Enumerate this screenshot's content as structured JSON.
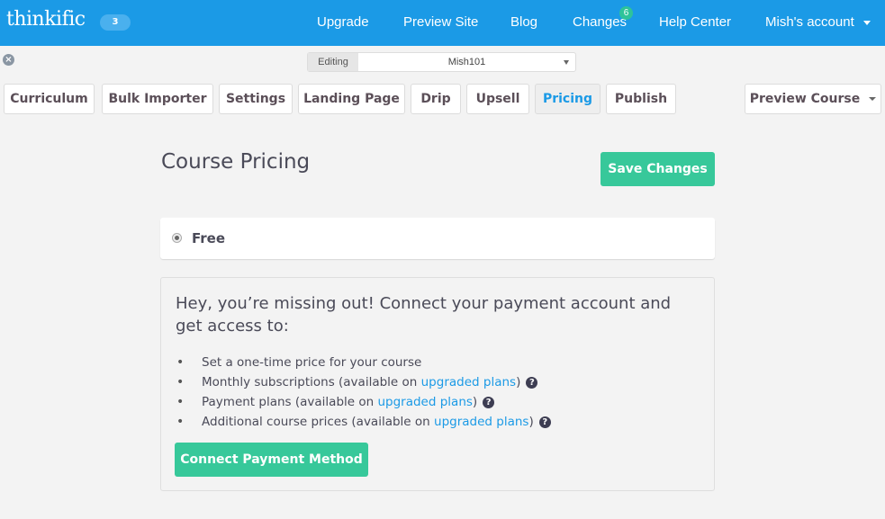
{
  "topbar": {
    "logo": "thinkific",
    "logo_badge": "3",
    "nav": [
      {
        "label": "Upgrade"
      },
      {
        "label": "Preview Site"
      },
      {
        "label": "Blog"
      },
      {
        "label": "Changes",
        "badge": "6"
      },
      {
        "label": "Help Center"
      },
      {
        "label": "Mish's account"
      }
    ]
  },
  "editing": {
    "label": "Editing",
    "selected": "Mish101"
  },
  "tabs": [
    {
      "label": "Curriculum"
    },
    {
      "label": "Bulk Importer"
    },
    {
      "label": "Settings"
    },
    {
      "label": "Landing Page"
    },
    {
      "label": "Drip"
    },
    {
      "label": "Upsell"
    },
    {
      "label": "Pricing",
      "active": true
    },
    {
      "label": "Publish"
    }
  ],
  "preview_course": "Preview Course",
  "content": {
    "title": "Course Pricing",
    "save_label": "Save Changes",
    "free_option": "Free",
    "upsell": {
      "heading": "Hey, you’re missing out! Connect your payment account and get access to:",
      "features": [
        {
          "text": "Set a one-time price for your course"
        },
        {
          "text": "Monthly subscriptions (available on ",
          "link": "upgraded plans",
          "suffix": ")",
          "help": "?"
        },
        {
          "text": "Payment plans (available on ",
          "link": "upgraded plans",
          "suffix": ")",
          "help": "?"
        },
        {
          "text": "Additional course prices (available on ",
          "link": "upgraded plans",
          "suffix": ")",
          "help": "?"
        }
      ],
      "bullet": "•",
      "connect_label": "Connect Payment Method"
    }
  },
  "icons": {
    "close": "×"
  },
  "colors": {
    "brand_blue": "#1b9ae6",
    "accent_green": "#37c89a",
    "badge_green": "#2ec39a"
  }
}
